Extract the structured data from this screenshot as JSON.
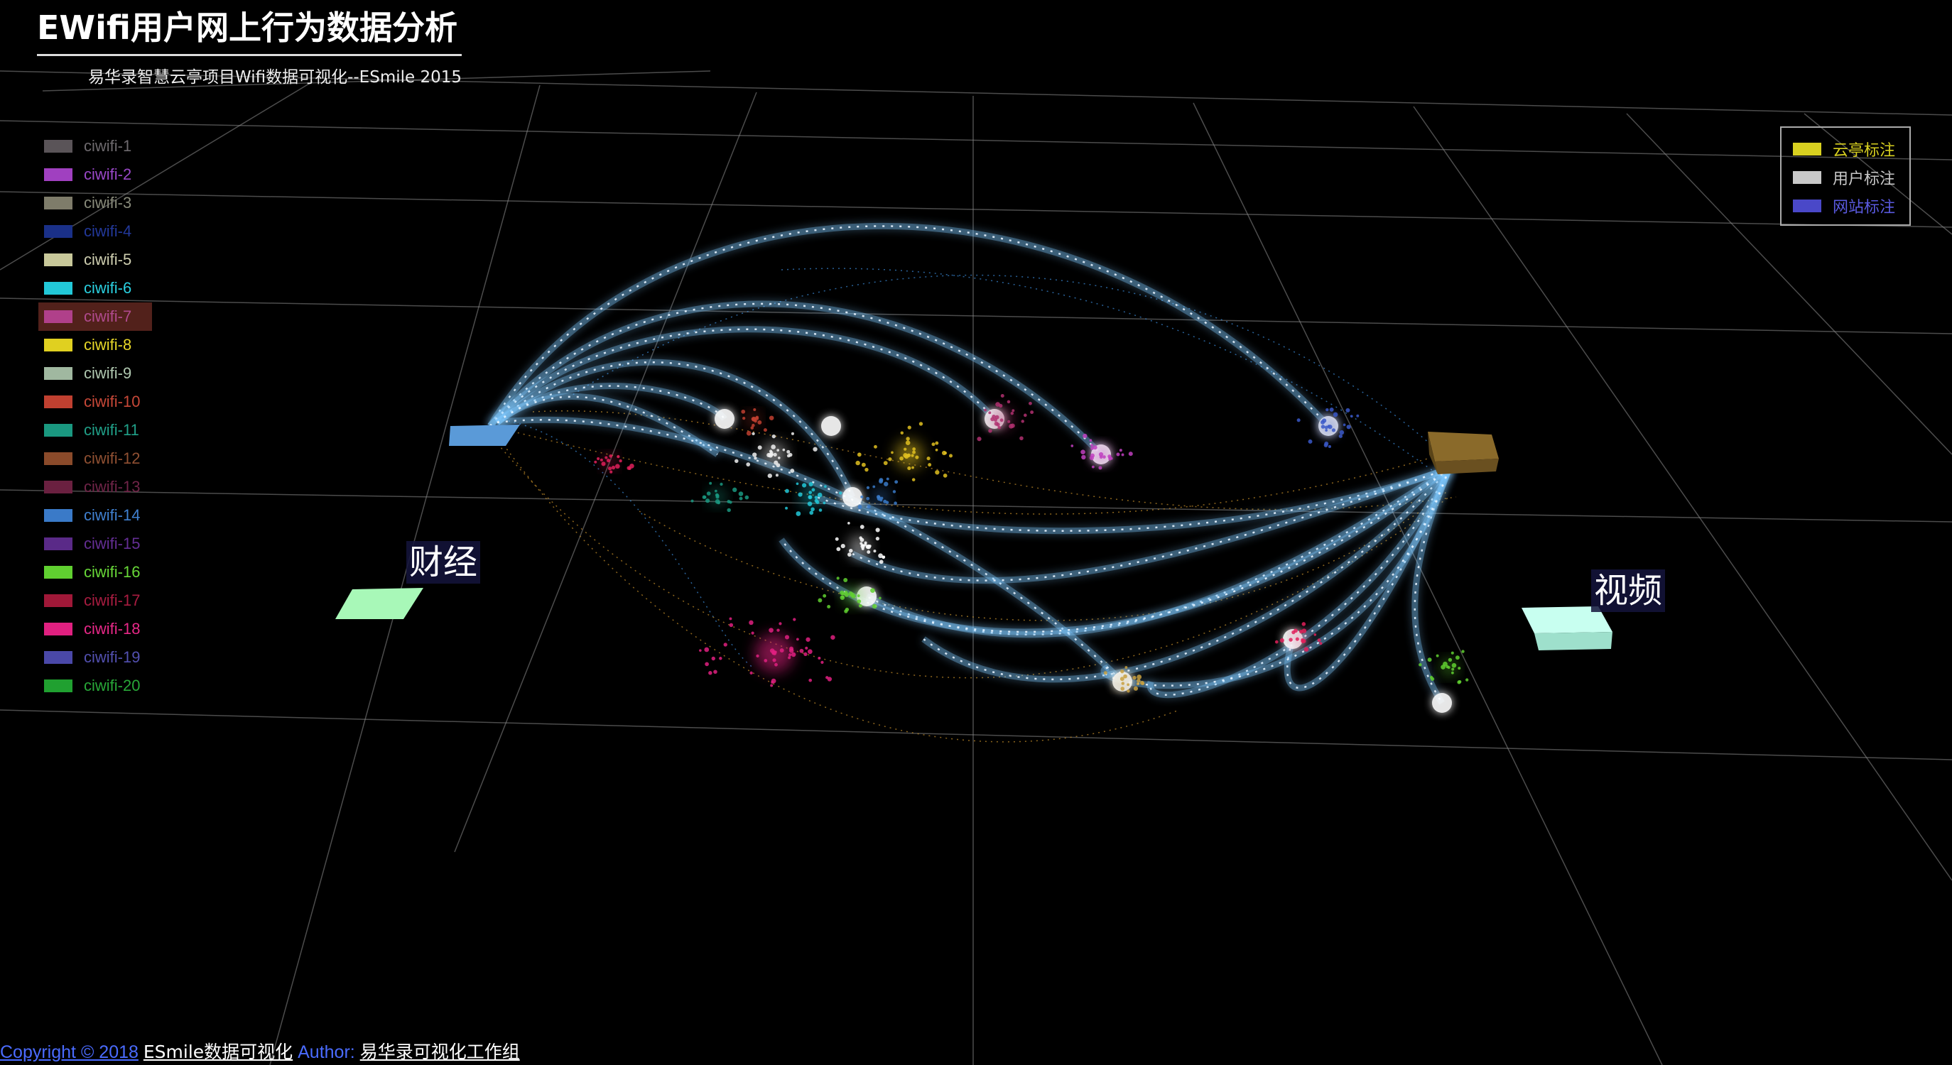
{
  "header": {
    "title": "EWifi用户网上行为数据分析",
    "subtitle": "易华录智慧云亭项目Wifi数据可视化--ESmile 2015"
  },
  "wifi_legend": [
    {
      "label": "ciwifi-1",
      "color": "#5a5458",
      "text_color": "#6e6a6e"
    },
    {
      "label": "ciwifi-2",
      "color": "#a040c0",
      "text_color": "#9a48c8"
    },
    {
      "label": "ciwifi-3",
      "color": "#7e7c6a",
      "text_color": "#888a7a"
    },
    {
      "label": "ciwifi-4",
      "color": "#1a3088",
      "text_color": "#22389a"
    },
    {
      "label": "ciwifi-5",
      "color": "#c8c89a",
      "text_color": "#cfcfb0"
    },
    {
      "label": "ciwifi-6",
      "color": "#22c8d8",
      "text_color": "#2ad0e0"
    },
    {
      "label": "ciwifi-7",
      "color": "#b0408a",
      "text_color": "#b04a8e"
    },
    {
      "label": "ciwifi-8",
      "color": "#e0d020",
      "text_color": "#e8d828"
    },
    {
      "label": "ciwifi-9",
      "color": "#a0b8a0",
      "text_color": "#b0c8b0"
    },
    {
      "label": "ciwifi-10",
      "color": "#c04030",
      "text_color": "#c84838"
    },
    {
      "label": "ciwifi-11",
      "color": "#1a9880",
      "text_color": "#20a088"
    },
    {
      "label": "ciwifi-12",
      "color": "#8a4a2a",
      "text_color": "#905032"
    },
    {
      "label": "ciwifi-13",
      "color": "#6a2040",
      "text_color": "#702448"
    },
    {
      "label": "ciwifi-14",
      "color": "#3a7ac8",
      "text_color": "#4080d0"
    },
    {
      "label": "ciwifi-15",
      "color": "#5a2a88",
      "text_color": "#642e94"
    },
    {
      "label": "ciwifi-16",
      "color": "#60d030",
      "text_color": "#68d838"
    },
    {
      "label": "ciwifi-17",
      "color": "#a01838",
      "text_color": "#a81c40"
    },
    {
      "label": "ciwifi-18",
      "color": "#e02080",
      "text_color": "#e82888"
    },
    {
      "label": "ciwifi-19",
      "color": "#4a48a8",
      "text_color": "#5250b0"
    },
    {
      "label": "ciwifi-20",
      "color": "#20a030",
      "text_color": "#28a838"
    }
  ],
  "wifi_hover_index": 6,
  "mark_legend": [
    {
      "label": "云亭标注",
      "color": "#d8d020",
      "text_color": "#d8d020"
    },
    {
      "label": "用户标注",
      "color": "#c8c8c8",
      "text_color": "#c8c8c8"
    },
    {
      "label": "网站标注",
      "color": "#4a48c8",
      "text_color": "#5a5ae0"
    }
  ],
  "categories": [
    {
      "label": "财经"
    },
    {
      "label": "视频"
    }
  ],
  "footer": {
    "copyright": "Copyright © 2018",
    "brand": "ESmile数据可视化",
    "author_label": "Author:",
    "author": "易华录可视化工作组"
  },
  "colors": {
    "background": "#000000",
    "grid": "#8a8a8a",
    "arc_glow": "#7fc8ff",
    "arc_core": "#e8f4ff",
    "thin_arc_orange": "#c8902a",
    "thin_arc_blue": "#3a8ad8",
    "kiosk_block": "#8a6a2a",
    "source_tile": "#5a9ad8",
    "finance_tile": "#a8f8b8",
    "video_tile": "#c8fff0"
  }
}
